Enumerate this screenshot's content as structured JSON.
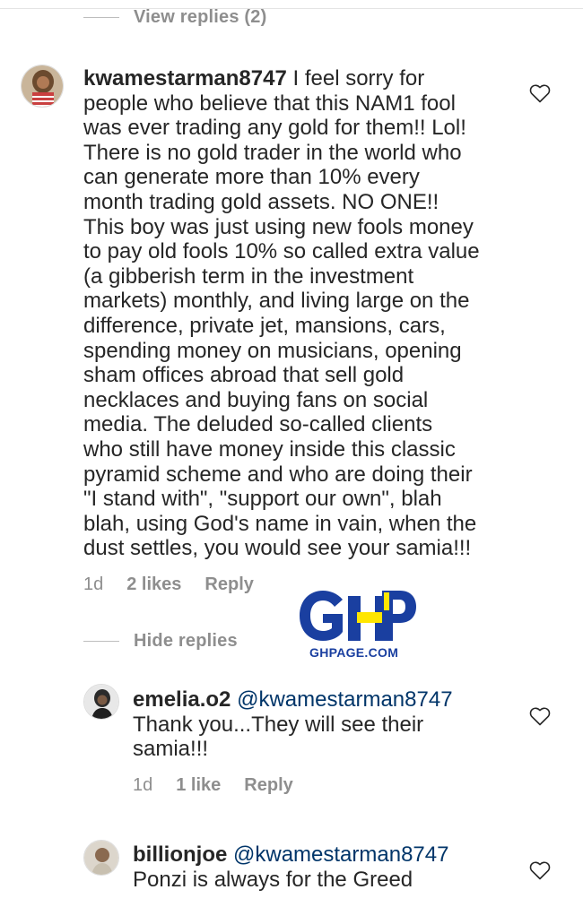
{
  "thread_toggle_top": {
    "label": "View replies (2)"
  },
  "comment_main": {
    "username": "kwamestarman8747",
    "text": " I feel sorry for\npeople who believe that this NAM1 fool\nwas ever trading any gold for them!! Lol!\nThere is no gold trader in the world who\ncan generate more than 10% every\nmonth trading gold assets. NO ONE!!\nThis boy was just using new fools money\nto pay old fools 10% so called extra value\n(a gibberish term in the investment\nmarkets) monthly, and living large on the\ndifference, private jet, mansions, cars,\nspending money on musicians, opening\nsham offices abroad that sell gold\nnecklaces and buying fans on social\nmedia. The deluded so-called clients\nwho still have money inside this classic\npyramid scheme and who are doing their\n\"I stand with\", \"support our own\", blah\nblah, using God's name in vain, when the\ndust settles, you would see your samia!!!",
    "time": "1d",
    "likes": "2 likes",
    "reply": "Reply"
  },
  "thread_toggle_hide": {
    "label": "Hide replies"
  },
  "reply_1": {
    "username": "emelia.o2",
    "mention": "@kwamestarman8747",
    "text": "Thank you...They will see their\nsamia!!!",
    "time": "1d",
    "likes": "1 like",
    "reply": "Reply"
  },
  "reply_2": {
    "username": "billionjoe",
    "mention": "@kwamestarman8747",
    "text": "Ponzi is always for the Greed"
  },
  "watermark": {
    "text": "GHPAGE.COM",
    "colors": {
      "blue": "#1a3fa0",
      "yellow": "#ffe600"
    }
  },
  "icons": {
    "like": "heart-outline-icon"
  }
}
